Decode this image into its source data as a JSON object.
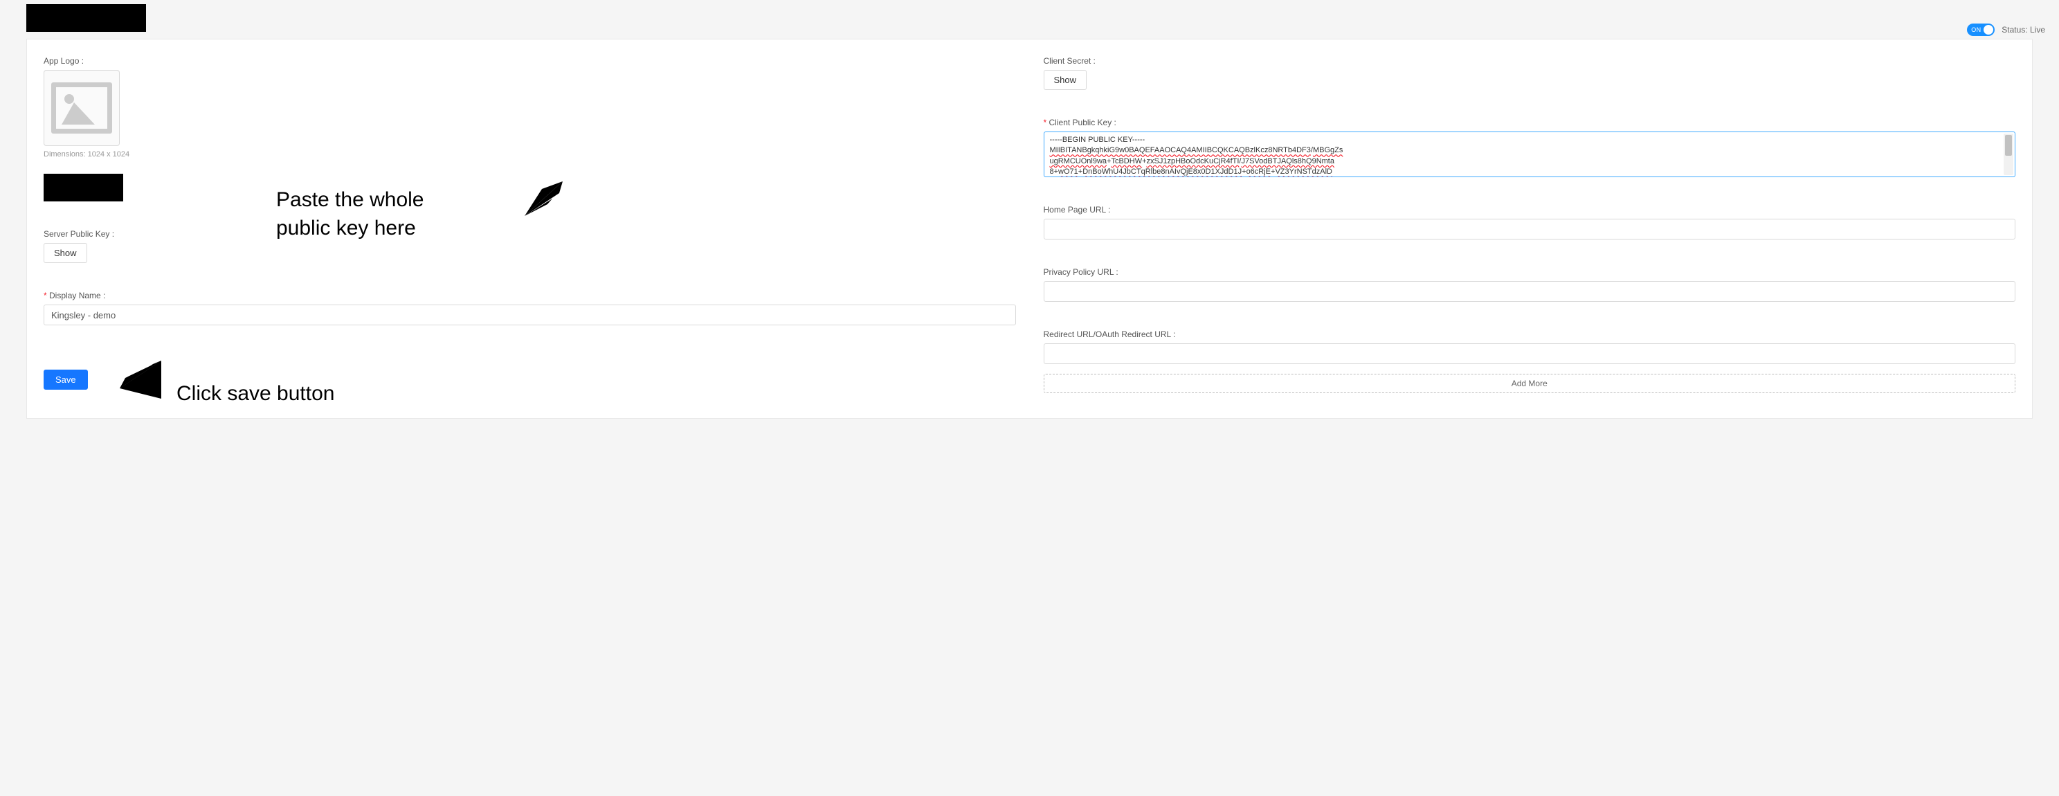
{
  "header": {
    "status_toggle": "ON",
    "status_label": "Status: Live"
  },
  "left": {
    "app_logo_label": "App Logo :",
    "dimensions": "Dimensions: 1024 x 1024",
    "server_public_key_label": "Server Public Key :",
    "show_button": "Show",
    "display_name_label": "Display Name :",
    "display_name_value": "Kingsley - demo",
    "save_button": "Save"
  },
  "right": {
    "client_secret_label": "Client Secret :",
    "client_secret_show": "Show",
    "client_public_key_label": "Client Public Key :",
    "public_key_line1": "-----BEGIN PUBLIC KEY-----",
    "public_key_seg_a": "MIIBITANBgkqhkiG9w0BAQEFAAOCAQ4AMIIBCQKCAQBzlKcz8NRTb4DF3",
    "public_key_sep1": "/",
    "public_key_seg_b": "MBGgZs",
    "public_key_seg_c": "ugRMCUOnl9wa",
    "public_key_sep2": "+",
    "public_key_seg_d": "TcBDHW",
    "public_key_seg_e": "zxSJ1zpHBoOdcKuCjR4fTI",
    "public_key_seg_f": "J7SVodBTJAQls8hQ9Nmta",
    "public_key_seg_g": "8+",
    "public_key_seg_h": "wO71",
    "public_key_seg_i": "DnBoWhU4JbCTqRlbe8nAIvQjE8x0D1XJdD1J",
    "public_key_seg_j": "o6cRjE",
    "public_key_seg_k": "VZ3YrNSTdzAlD",
    "home_page_label": "Home Page URL :",
    "privacy_label": "Privacy Policy URL :",
    "redirect_label": "Redirect URL/OAuth Redirect URL :",
    "add_more": "Add More"
  },
  "annotations": {
    "line1a": "Paste the whole",
    "line1b": "public key here",
    "line2": "Click save button"
  }
}
